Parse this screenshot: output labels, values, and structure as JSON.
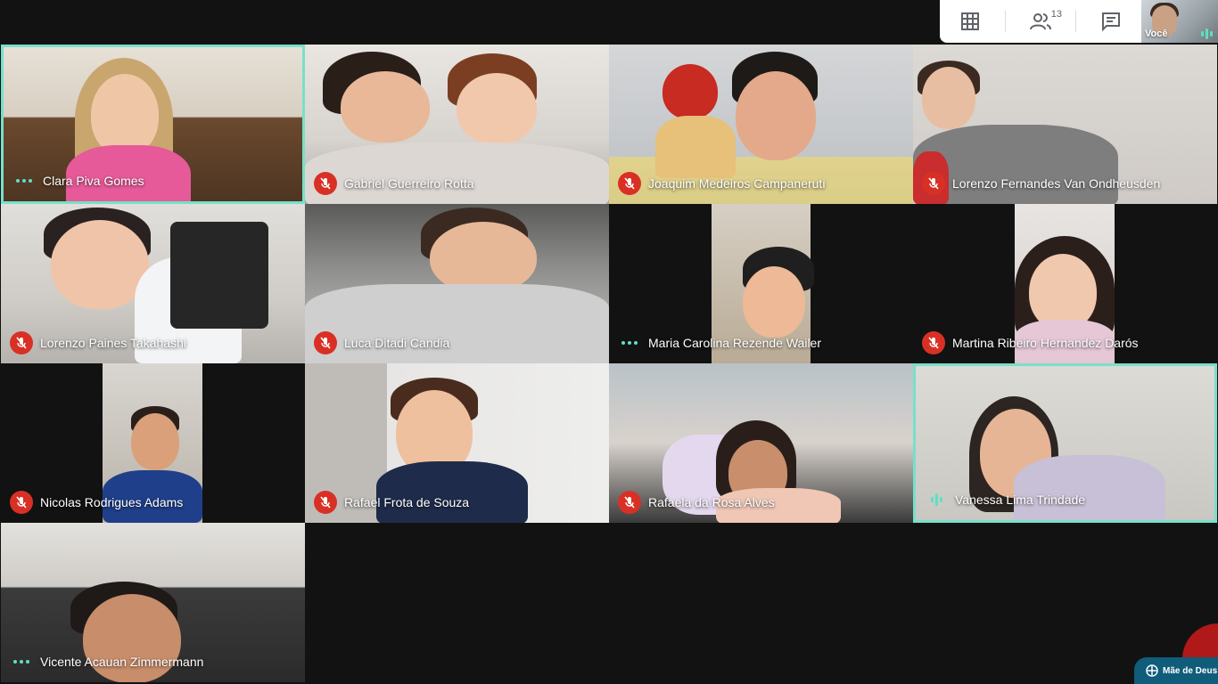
{
  "toolbar": {
    "grid_icon": "grid-layout-icon",
    "people_icon": "people-icon",
    "people_count": "13",
    "chat_icon": "chat-icon"
  },
  "self_view": {
    "label": "Você"
  },
  "participants": [
    {
      "name": "Clara Piva Gomes",
      "status": "dots"
    },
    {
      "name": "Gabriel Guerreiro Rotta",
      "status": "muted"
    },
    {
      "name": "Joaquim Medeiros Campaneruti",
      "status": "muted"
    },
    {
      "name": "Lorenzo Fernandes Van Ondheusden",
      "status": "muted"
    },
    {
      "name": "Lorenzo Paines Takahashi",
      "status": "muted"
    },
    {
      "name": "Luca Ditadi Candia",
      "status": "muted"
    },
    {
      "name": "Maria Carolina Rezende Wailer",
      "status": "dots"
    },
    {
      "name": "Martina Ribeiro Hernandez Darós",
      "status": "muted"
    },
    {
      "name": "Nicolas Rodrigues Adams",
      "status": "muted"
    },
    {
      "name": "Rafael Frota de Souza",
      "status": "muted"
    },
    {
      "name": "Rafaela da Rosa Alves",
      "status": "muted"
    },
    {
      "name": "Vanessa Lima Trindade",
      "status": "speaking"
    },
    {
      "name": "Vicente Acauan Zimmermann",
      "status": "dots"
    }
  ],
  "logo": {
    "text": "Mãe de Deus"
  },
  "colors": {
    "accent": "#78e0c8",
    "mute_red": "#d93025",
    "background": "#121212"
  }
}
